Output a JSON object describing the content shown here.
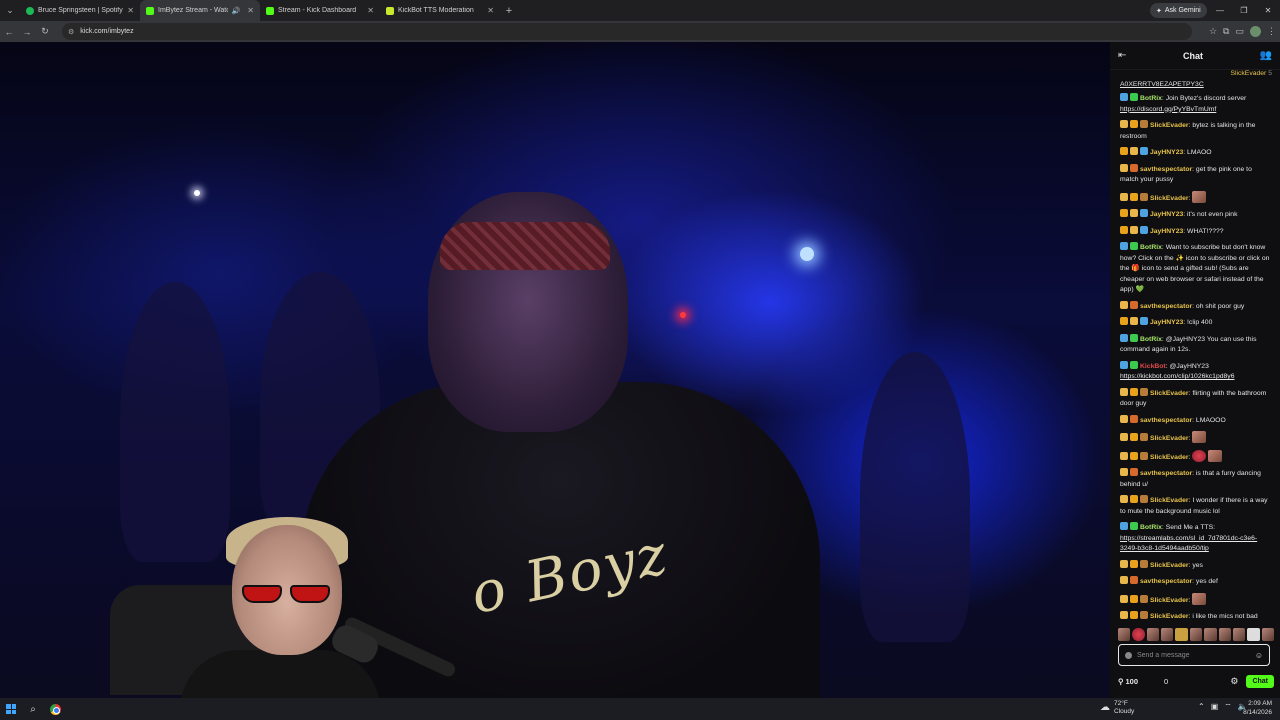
{
  "browser": {
    "tabs": [
      {
        "label": "Bruce Springsteen | Spotify",
        "color": "#1db954",
        "active": false
      },
      {
        "label": "ImBytez Stream - Watch Li",
        "color": "#53fc18",
        "active": true
      },
      {
        "label": "Stream - Kick Dashboard",
        "color": "#53fc18",
        "active": false
      },
      {
        "label": "KickBot TTS Moderation",
        "color": "#53fc18",
        "active": false
      }
    ],
    "ask_gemini": "Ask Gemini",
    "url": "kick.com/imbytez"
  },
  "video": {
    "shirt_text": "o Boyz"
  },
  "chat": {
    "title": "Chat",
    "top_user": "SlickEvader",
    "top_suffix": "5",
    "first_line": "A0XERRTV8EZAPETPY3C",
    "messages": [
      {
        "badges": [
          "mod",
          "ver"
        ],
        "user": "BotRix",
        "color": "#a7e36b",
        "text": "Join Bytez's discord server",
        "link": "https://discord.gg/PyYBvTmUmf"
      },
      {
        "badges": [
          "sub",
          "vip",
          "gift"
        ],
        "user": "SlickEvader",
        "color": "#e8c34a",
        "text": "bytez is talking in the restroom"
      },
      {
        "badges": [
          "vip",
          "sub",
          "mod"
        ],
        "user": "JayHNY23",
        "color": "#e8c34a",
        "text": "LMAOO"
      },
      {
        "badges": [
          "sub",
          "ogg"
        ],
        "user": "savthespectator",
        "color": "#e8c34a",
        "text": "get the pink one to match your pussy"
      },
      {
        "badges": [
          "sub",
          "vip",
          "gift"
        ],
        "user": "SlickEvader",
        "color": "#e8c34a",
        "text": "",
        "emote": "face"
      },
      {
        "badges": [
          "vip",
          "sub",
          "mod"
        ],
        "user": "JayHNY23",
        "color": "#e8c34a",
        "text": "it's not even pink"
      },
      {
        "badges": [
          "vip",
          "sub",
          "mod"
        ],
        "user": "JayHNY23",
        "color": "#e8c34a",
        "text": "WHAT!????"
      },
      {
        "badges": [
          "mod",
          "ver"
        ],
        "user": "BotRix",
        "color": "#a7e36b",
        "text": "Want to subscribe but don't know how? Click on the ✨ icon to subscribe or click on the 🎁 icon to send a gifted sub! (Subs are cheaper on web browser or safari instead of the app) 💚"
      },
      {
        "badges": [
          "sub",
          "ogg"
        ],
        "user": "savthespectator",
        "color": "#e8c34a",
        "text": "oh shit poor guy"
      },
      {
        "badges": [
          "vip",
          "sub",
          "mod"
        ],
        "user": "JayHNY23",
        "color": "#e8c34a",
        "text": "!clip 400"
      },
      {
        "badges": [
          "mod",
          "ver"
        ],
        "user": "BotRix",
        "color": "#a7e36b",
        "text": "@JayHNY23 You can use this command again in 12s."
      },
      {
        "badges": [
          "mod",
          "ver"
        ],
        "user": "KickBot",
        "color": "#e04a4a",
        "text": "@JayHNY23",
        "link": "https://kickbot.com/clip/1026kc1pd8y6"
      },
      {
        "badges": [
          "sub",
          "vip",
          "gift"
        ],
        "user": "SlickEvader",
        "color": "#e8c34a",
        "text": "flirting with the bathroom door guy"
      },
      {
        "badges": [
          "sub",
          "ogg"
        ],
        "user": "savthespectator",
        "color": "#e8c34a",
        "text": "LMAOOO"
      },
      {
        "badges": [
          "sub",
          "vip",
          "gift"
        ],
        "user": "SlickEvader",
        "color": "#e8c34a",
        "text": "",
        "emote": "face"
      },
      {
        "badges": [
          "sub",
          "vip",
          "gift"
        ],
        "user": "SlickEvader",
        "color": "#e8c34a",
        "text": "",
        "emote": "red2"
      },
      {
        "badges": [
          "sub",
          "ogg"
        ],
        "user": "savthespectator",
        "color": "#e8c34a",
        "text": "is that a furry dancing behind u/"
      },
      {
        "badges": [
          "sub",
          "vip",
          "gift"
        ],
        "user": "SlickEvader",
        "color": "#e8c34a",
        "text": "I wonder if there is a way to mute the background music lol"
      },
      {
        "badges": [
          "mod",
          "ver"
        ],
        "user": "BotRix",
        "color": "#a7e36b",
        "text": "Send Me a TTS:",
        "link": "https://streamlabs.com/sl_id_7d7801dc-c3e6-3249-b3c8-1d5494aadb50/tip"
      },
      {
        "badges": [
          "sub",
          "vip",
          "gift"
        ],
        "user": "SlickEvader",
        "color": "#e8c34a",
        "text": "yes"
      },
      {
        "badges": [
          "sub",
          "ogg"
        ],
        "user": "savthespectator",
        "color": "#e8c34a",
        "text": "yes def"
      },
      {
        "badges": [
          "sub",
          "vip",
          "gift"
        ],
        "user": "SlickEvader",
        "color": "#e8c34a",
        "text": "",
        "emote": "face"
      },
      {
        "badges": [
          "sub",
          "vip",
          "gift"
        ],
        "user": "SlickEvader",
        "color": "#e8c34a",
        "text": "i like the mics not bad"
      }
    ],
    "input_placeholder": "Send a message",
    "points": "100",
    "zero": "0",
    "send_label": "Chat"
  },
  "taskbar": {
    "temp": "72°F",
    "weather": "Cloudy",
    "time": "2:09 AM",
    "date": "8/14/2026"
  },
  "colors": {
    "kick_green": "#53fc18"
  }
}
